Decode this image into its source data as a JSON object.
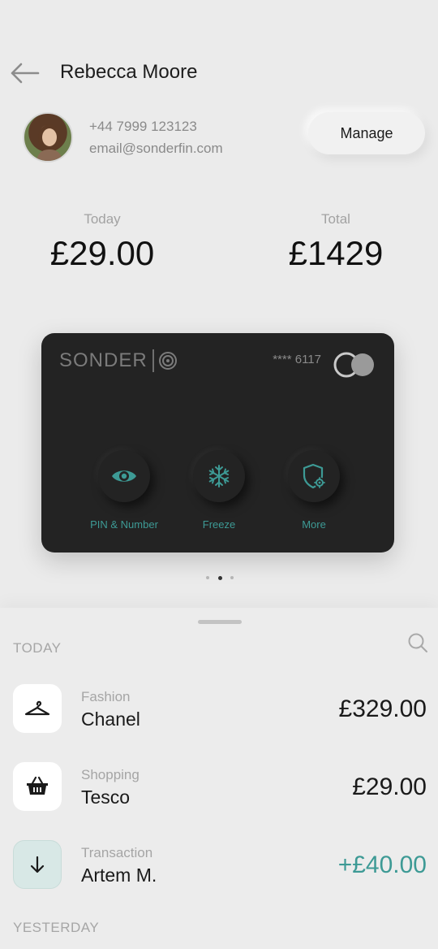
{
  "header": {
    "title": "Rebecca Moore"
  },
  "profile": {
    "phone": "+44 7999 123123",
    "email": "email@sonderfin.com",
    "manage_label": "Manage"
  },
  "stats": {
    "today_label": "Today",
    "today_value": "£29.00",
    "total_label": "Total",
    "total_value": "£1429"
  },
  "card": {
    "brand": "SONDER",
    "number": "**** 6117",
    "actions": [
      {
        "label": "PIN & Number",
        "icon": "eye-icon"
      },
      {
        "label": "Freeze",
        "icon": "snowflake-icon"
      },
      {
        "label": "More",
        "icon": "shield-gear-icon"
      }
    ],
    "accent": "#3d9a95",
    "pager": {
      "count": 3,
      "active": 2
    }
  },
  "transactions": {
    "today_label": "TODAY",
    "yesterday_label": "YESTERDAY",
    "items": [
      {
        "category": "Fashion",
        "name": "Chanel",
        "amount": "£329.00",
        "icon": "hanger-icon"
      },
      {
        "category": "Shopping",
        "name": "Tesco",
        "amount": "£29.00",
        "icon": "basket-icon"
      },
      {
        "category": "Transaction",
        "name": "Artem M.",
        "amount": "+£40.00",
        "icon": "arrow-down-icon"
      }
    ]
  }
}
